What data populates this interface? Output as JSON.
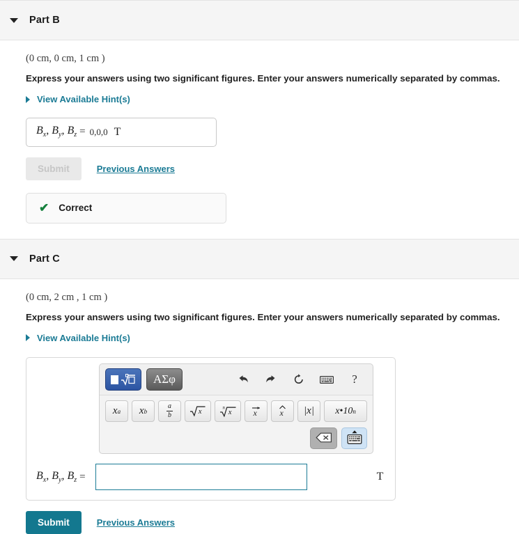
{
  "parts": [
    {
      "id": "part-b",
      "title": "Part B",
      "caret_icon": "caret-down-icon",
      "coordinates": "(0 cm, 0 cm, 1 cm )",
      "instruction": "Express your answers using two significant figures. Enter your answers numerically separated by commas.",
      "hint_label": "View Available Hint(s)",
      "answer": {
        "variables": "Bx, By, Bz",
        "equals": "=",
        "value": "0,0,0",
        "unit": "T"
      },
      "submit_label": "Submit",
      "submit_enabled": false,
      "previous_answers_label": "Previous Answers",
      "feedback": {
        "icon": "check-icon",
        "text": "Correct"
      }
    },
    {
      "id": "part-c",
      "title": "Part C",
      "caret_icon": "caret-down-icon",
      "coordinates": "(0 cm, 2 cm , 1 cm )",
      "instruction": "Express your answers using two significant figures. Enter your answers numerically separated by commas.",
      "hint_label": "View Available Hint(s)",
      "answer": {
        "variables": "Bx, By, Bz",
        "equals": "=",
        "value": "",
        "unit": "T"
      },
      "submit_label": "Submit",
      "submit_enabled": true,
      "previous_answers_label": "Previous Answers"
    }
  ],
  "math_editor": {
    "mode_buttons": [
      {
        "name": "math-template-mode",
        "label": "",
        "icon": "square-radical-icon",
        "active": true
      },
      {
        "name": "greek-symbols-mode",
        "label": "ΑΣφ",
        "icon": "greek-letters-icon",
        "active": false
      }
    ],
    "tool_icons": [
      {
        "name": "undo-icon",
        "title": "undo"
      },
      {
        "name": "redo-icon",
        "title": "redo"
      },
      {
        "name": "reset-icon",
        "title": "reset"
      },
      {
        "name": "keyboard-icon",
        "title": "keyboard"
      },
      {
        "name": "help-icon",
        "title": "?",
        "glyph": "?"
      }
    ],
    "keys": [
      {
        "name": "superscript-key",
        "label": "x",
        "sup": "a"
      },
      {
        "name": "subscript-key",
        "label": "x",
        "sub": "b"
      },
      {
        "name": "fraction-key",
        "num": "a",
        "den": "b"
      },
      {
        "name": "square-root-key",
        "label": "√x"
      },
      {
        "name": "nth-root-key",
        "label": "ⁿ√x"
      },
      {
        "name": "vector-key",
        "label": "x⃗"
      },
      {
        "name": "unit-vector-key",
        "label": "x̂"
      },
      {
        "name": "absolute-value-key",
        "label": "|x|"
      },
      {
        "name": "scientific-notation-key",
        "label": "x•10",
        "sup": "n"
      }
    ],
    "bottom_keys": [
      {
        "name": "backspace-key",
        "icon": "backspace-icon"
      },
      {
        "name": "hide-keyboard-key",
        "icon": "keyboard-hide-icon"
      }
    ]
  },
  "colors": {
    "accent": "#13788f",
    "link": "#1b7b95",
    "correct": "#15803d",
    "header_bg": "#f5f5f5",
    "mode_active": "#2d55a3"
  }
}
